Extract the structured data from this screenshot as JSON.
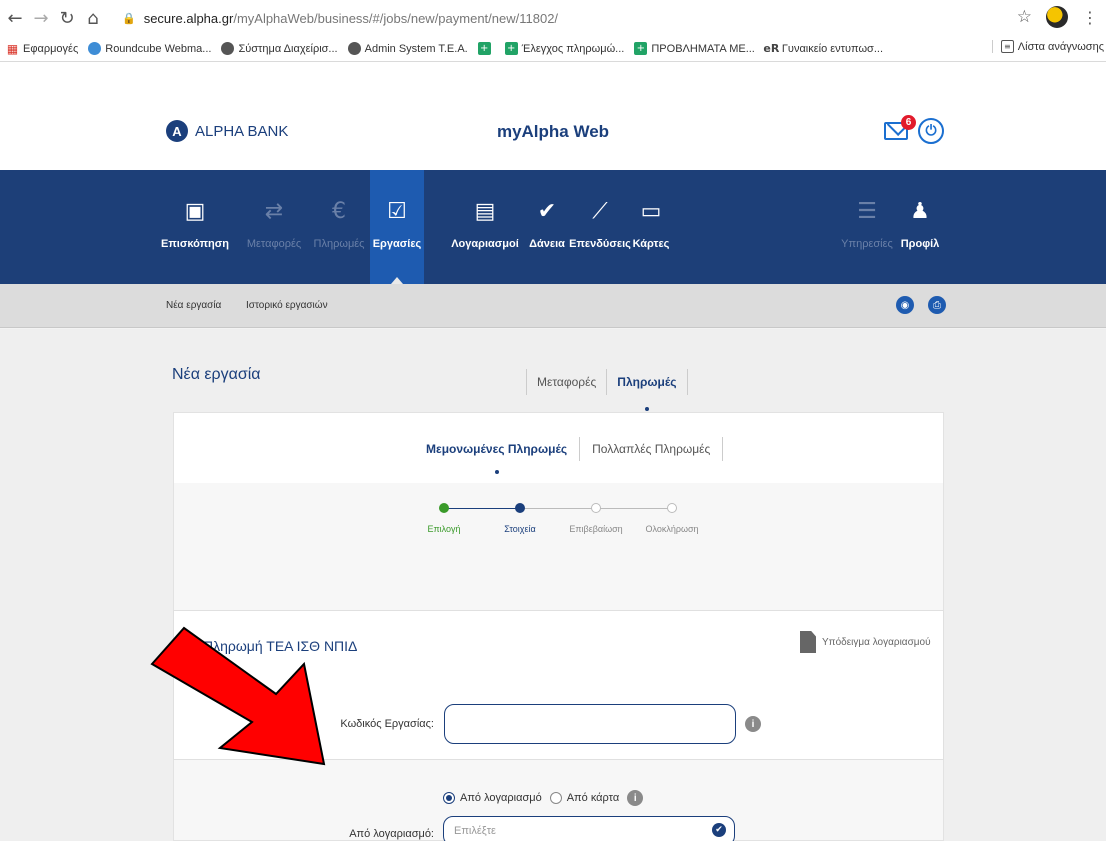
{
  "browser": {
    "url_host": "secure.alpha.gr",
    "url_path": "/myAlphaWeb/business/#/jobs/new/payment/new/11802/",
    "bookmarks": [
      {
        "label": "Εφαρμογές",
        "icon": "apps-grid-icon"
      },
      {
        "label": "Roundcube Webma...",
        "icon": "roundcube-icon"
      },
      {
        "label": "Σύστημα Διαχείρισ...",
        "icon": "globe-icon"
      },
      {
        "label": "Admin System T.E.A.",
        "icon": "globe-icon"
      },
      {
        "label": "",
        "icon": "sheets-icon"
      },
      {
        "label": "Έλεγχος πληρωμώ...",
        "icon": "sheets-icon"
      },
      {
        "label": "ΠΡΟΒΛΗΜΑΤΑ ΜΕ...",
        "icon": "sheets-icon"
      },
      {
        "label": "Γυναικείο εντυπωσ...",
        "icon": "er-icon"
      }
    ],
    "reading_list": "Λίστα ανάγνωσης"
  },
  "header": {
    "logo_text": "ALPHA BANK",
    "site_title": "myAlpha Web",
    "mail_badge": "6"
  },
  "nav": {
    "items": [
      {
        "label": "Επισκόπηση",
        "icon": "overview-icon"
      },
      {
        "label": "Μεταφορές",
        "icon": "transfers-icon"
      },
      {
        "label": "Πληρωμές",
        "icon": "payments-icon"
      },
      {
        "label": "Εργασίες",
        "icon": "tasks-icon"
      },
      {
        "label": "Λογαριασμοί",
        "icon": "wallet-icon"
      },
      {
        "label": "Δάνεια",
        "icon": "loans-icon"
      },
      {
        "label": "Επενδύσεις",
        "icon": "investments-icon"
      },
      {
        "label": "Κάρτες",
        "icon": "cards-icon"
      },
      {
        "label": "Υπηρεσίες",
        "icon": "services-icon"
      },
      {
        "label": "Προφίλ",
        "icon": "profile-icon"
      }
    ]
  },
  "subnav": {
    "new_task": "Νέα εργασία",
    "history": "Ιστορικό εργασιών"
  },
  "page": {
    "title": "Νέα εργασία",
    "tabs": [
      "Μεταφορές",
      "Πληρωμές"
    ],
    "inner_tabs": [
      "Μεμονωμένες Πληρωμές",
      "Πολλαπλές Πληρωμές"
    ],
    "steps": [
      "Επιλογή",
      "Στοιχεία",
      "Επιβεβαίωση",
      "Ολοκλήρωση"
    ]
  },
  "form": {
    "title": "Πληρωμή ΤΕΑ ΙΣΘ ΝΠΙΔ",
    "template_link": "Υπόδειγμα λογαριασμού",
    "code_label": "Κωδικός Εργασίας:",
    "code_value": "",
    "radio_account": "Από λογαριασμό",
    "radio_card": "Από κάρτα",
    "account_label": "Από λογαριασμό:",
    "account_placeholder": "Επιλέξτε"
  }
}
